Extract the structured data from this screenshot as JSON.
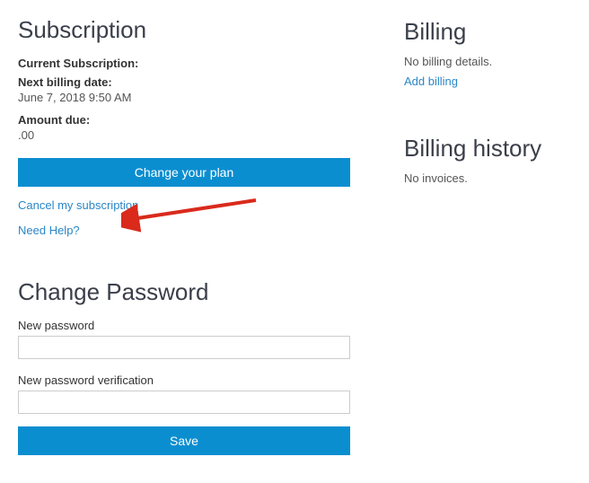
{
  "subscription": {
    "heading": "Subscription",
    "current_label": "Current Subscription:",
    "next_label": "Next billing date:",
    "next_value": "June 7, 2018 9:50 AM",
    "amount_label": "Amount due:",
    "amount_value": ".00",
    "change_plan_btn": "Change your plan",
    "cancel_link": "Cancel my subscription",
    "help_link": "Need Help?"
  },
  "password": {
    "heading": "Change Password",
    "new_label": "New password",
    "verify_label": "New password verification",
    "save_btn": "Save"
  },
  "billing": {
    "heading": "Billing",
    "no_details": "No billing details.",
    "add_link": "Add billing"
  },
  "history": {
    "heading": "Billing history",
    "no_invoices": "No invoices."
  }
}
